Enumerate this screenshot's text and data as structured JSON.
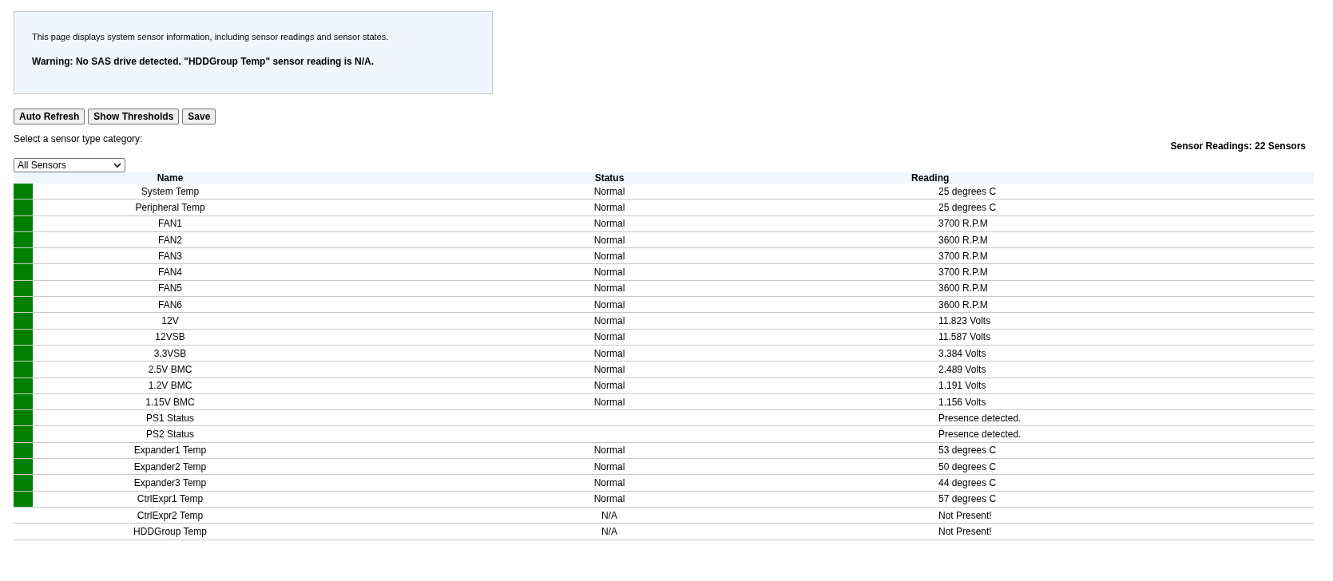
{
  "info": {
    "description": "This page displays system sensor information, including sensor readings and sensor states.",
    "warning": "Warning: No SAS drive detected. \"HDDGroup Temp\" sensor reading is N/A."
  },
  "buttons": [
    "Auto Refresh",
    "Show Thresholds",
    "Save"
  ],
  "category": {
    "label": "Select a sensor type category:",
    "value": "All Sensors"
  },
  "summary": "Sensor Readings: 22 Sensors",
  "table": {
    "columns": [
      "Name",
      "Status",
      "Reading"
    ],
    "rows": [
      {
        "name": "System Temp",
        "status": "Normal",
        "reading": "25 degrees C",
        "color": "#008000"
      },
      {
        "name": "Peripheral Temp",
        "status": "Normal",
        "reading": "25 degrees C",
        "color": "#008000"
      },
      {
        "name": "FAN1",
        "status": "Normal",
        "reading": "3700 R.P.M",
        "color": "#008000"
      },
      {
        "name": "FAN2",
        "status": "Normal",
        "reading": "3600 R.P.M",
        "color": "#008000"
      },
      {
        "name": "FAN3",
        "status": "Normal",
        "reading": "3700 R.P.M",
        "color": "#008000"
      },
      {
        "name": "FAN4",
        "status": "Normal",
        "reading": "3700 R.P.M",
        "color": "#008000"
      },
      {
        "name": "FAN5",
        "status": "Normal",
        "reading": "3600 R.P.M",
        "color": "#008000"
      },
      {
        "name": "FAN6",
        "status": "Normal",
        "reading": "3600 R.P.M",
        "color": "#008000"
      },
      {
        "name": "12V",
        "status": "Normal",
        "reading": "11.823 Volts",
        "color": "#008000"
      },
      {
        "name": "12VSB",
        "status": "Normal",
        "reading": "11.587 Volts",
        "color": "#008000"
      },
      {
        "name": "3.3VSB",
        "status": "Normal",
        "reading": "3.384 Volts",
        "color": "#008000"
      },
      {
        "name": "2.5V BMC",
        "status": "Normal",
        "reading": "2.489 Volts",
        "color": "#008000"
      },
      {
        "name": "1.2V BMC",
        "status": "Normal",
        "reading": "1.191 Volts",
        "color": "#008000"
      },
      {
        "name": "1.15V BMC",
        "status": "Normal",
        "reading": "1.156 Volts",
        "color": "#008000"
      },
      {
        "name": "PS1 Status",
        "reading": "Presence detected.",
        "color": "#008000"
      },
      {
        "name": "PS2 Status",
        "reading": "Presence detected.",
        "color": "#008000"
      },
      {
        "name": "Expander1 Temp",
        "status": "Normal",
        "reading": "53 degrees C",
        "color": "#008000"
      },
      {
        "name": "Expander2 Temp",
        "status": "Normal",
        "reading": "50 degrees C",
        "color": "#008000"
      },
      {
        "name": "Expander3 Temp",
        "status": "Normal",
        "reading": "44 degrees C",
        "color": "#008000"
      },
      {
        "name": "CtrlExpr1 Temp",
        "status": "Normal",
        "reading": "57 degrees C",
        "color": "#008000"
      },
      {
        "name": "CtrlExpr2 Temp",
        "status": "N/A",
        "reading": "Not Present!"
      },
      {
        "name": "HDDGroup Temp",
        "status": "N/A",
        "reading": "Not Present!"
      }
    ]
  }
}
